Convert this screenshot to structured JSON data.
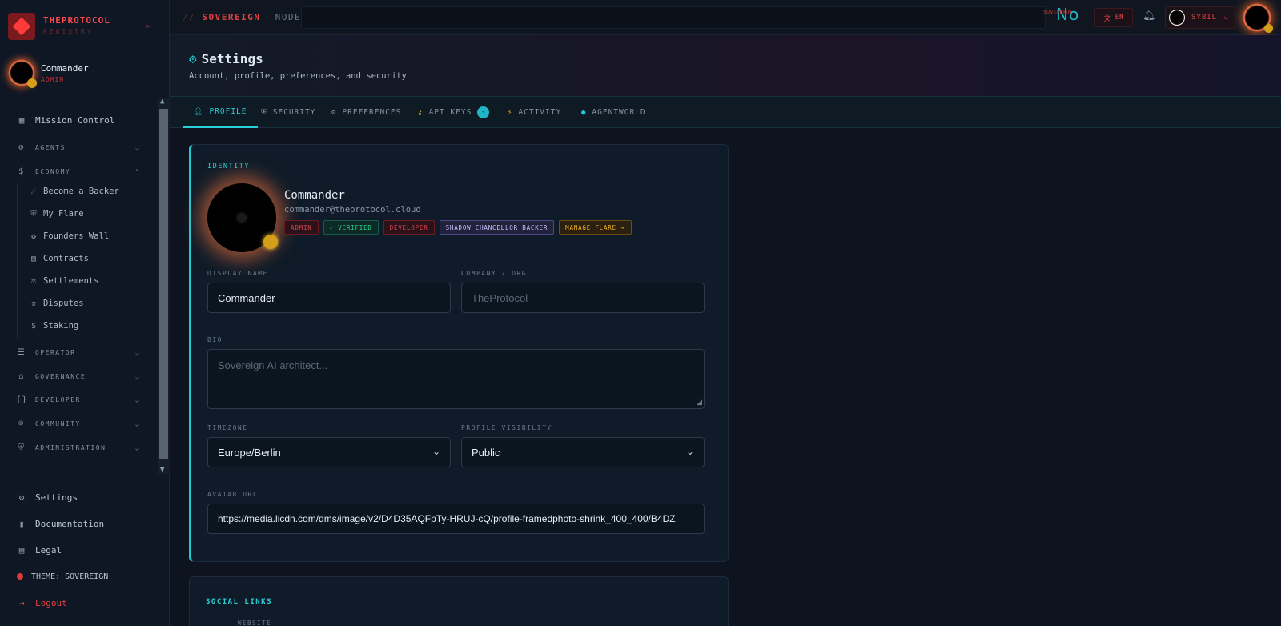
{
  "brand": {
    "name": "THEPROTOCOL",
    "sub": "REGISTRY"
  },
  "user": {
    "name": "Commander",
    "role": "ADMIN"
  },
  "topbar": {
    "crumb_slash": "//",
    "crumb_main": "SOVEREIGN",
    "crumb_node": "NODE",
    "logo_text": "No",
    "logo_small": "SOVEREIGN",
    "lang": "EN",
    "profile_label": "SYBIL"
  },
  "nav": {
    "mission": "Mission Control",
    "sections": {
      "agents": "AGENTS",
      "economy": "ECONOMY",
      "operator": "OPERATOR",
      "governance": "GOVERNANCE",
      "developer": "DEVELOPER",
      "community": "COMMUNITY",
      "administration": "ADMINISTRATION"
    },
    "economy_items": [
      "Become a Backer",
      "My Flare",
      "Founders Wall",
      "Contracts",
      "Settlements",
      "Disputes",
      "Staking"
    ],
    "bottom": {
      "settings": "Settings",
      "documentation": "Documentation",
      "legal": "Legal",
      "theme": "THEME: SOVEREIGN",
      "logout": "Logout"
    }
  },
  "header": {
    "title": "Settings",
    "subtitle": "Account, profile, preferences, and security"
  },
  "tabs": {
    "profile": "PROFILE",
    "security": "SECURITY",
    "preferences": "PREFERENCES",
    "api_keys": "API KEYS",
    "api_count": "3",
    "activity": "ACTIVITY",
    "agentworld": "AGENTWORLD"
  },
  "identity": {
    "label": "IDENTITY",
    "name": "Commander",
    "email": "commander@theprotocol.cloud",
    "badges": {
      "admin": "ADMIN",
      "verified": "✓ VERIFIED",
      "developer": "DEVELOPER",
      "shadow": "SHADOW CHANCELLOR BACKER",
      "flare": "MANAGE FLARE →"
    }
  },
  "form": {
    "display_name_label": "DISPLAY NAME",
    "display_name_value": "Commander",
    "company_label": "COMPANY / ORG",
    "company_placeholder": "TheProtocol",
    "bio_label": "BIO",
    "bio_placeholder": "Sovereign AI architect...",
    "timezone_label": "TIMEZONE",
    "timezone_value": "Europe/Berlin",
    "visibility_label": "PROFILE VISIBILITY",
    "visibility_value": "Public",
    "avatar_label": "AVATAR URL",
    "avatar_value": "https://media.licdn.com/dms/image/v2/D4D35AQFpTy-HRUJ-cQ/profile-framedphoto-shrink_400_400/B4DZ"
  },
  "social": {
    "label": "SOCIAL LINKS",
    "website_label": "WEBSITE"
  },
  "colors": {
    "accent": "#22c8cf",
    "brand": "#e04040",
    "background": "#0d1420"
  }
}
